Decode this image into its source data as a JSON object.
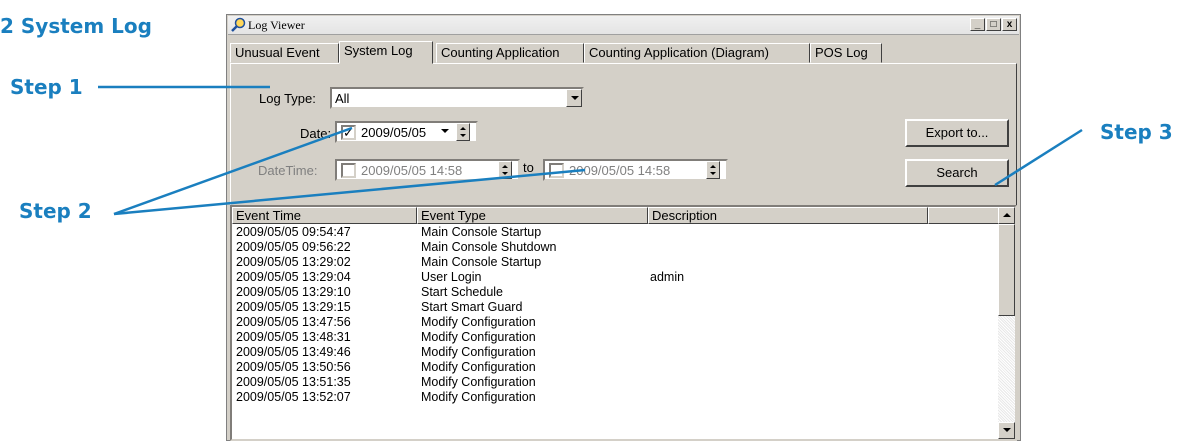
{
  "annotations": {
    "page_title": "2 System Log",
    "step1": "Step 1",
    "step2": "Step 2",
    "step3": "Step 3",
    "color": "#1a7fbf"
  },
  "window": {
    "title": "Log Viewer",
    "icon": "magnifier-icon",
    "controls": [
      "_",
      "□",
      "x"
    ]
  },
  "tabs": [
    {
      "label": "Unusual Event",
      "active": false
    },
    {
      "label": "System Log",
      "active": true
    },
    {
      "label": "Counting Application",
      "active": false
    },
    {
      "label": "Counting Application (Diagram)",
      "active": false
    },
    {
      "label": "POS Log",
      "active": false
    }
  ],
  "filters": {
    "log_type_label": "Log Type:",
    "log_type_value": "All",
    "date_label": "Date:",
    "date_checked": true,
    "date_value": "2009/05/05",
    "datetime_label": "DateTime:",
    "datetime_from": "2009/05/05 14:58",
    "datetime_to_label": "to",
    "datetime_to": "2009/05/05 14:58"
  },
  "buttons": {
    "export": "Export to...",
    "search": "Search"
  },
  "table": {
    "columns": [
      "Event Time",
      "Event Type",
      "Description"
    ],
    "rows": [
      [
        "2009/05/05 09:54:47",
        "Main Console Startup",
        ""
      ],
      [
        "2009/05/05 09:56:22",
        "Main Console Shutdown",
        ""
      ],
      [
        "2009/05/05 13:29:02",
        "Main Console Startup",
        ""
      ],
      [
        "2009/05/05 13:29:04",
        "User Login",
        "admin"
      ],
      [
        "2009/05/05 13:29:10",
        "Start Schedule",
        ""
      ],
      [
        "2009/05/05 13:29:15",
        "Start Smart Guard",
        ""
      ],
      [
        "2009/05/05 13:47:56",
        "Modify Configuration",
        ""
      ],
      [
        "2009/05/05 13:48:31",
        "Modify Configuration",
        ""
      ],
      [
        "2009/05/05 13:49:46",
        "Modify Configuration",
        ""
      ],
      [
        "2009/05/05 13:50:56",
        "Modify Configuration",
        ""
      ],
      [
        "2009/05/05 13:51:35",
        "Modify Configuration",
        ""
      ],
      [
        "2009/05/05 13:52:07",
        "Modify Configuration",
        ""
      ]
    ]
  }
}
